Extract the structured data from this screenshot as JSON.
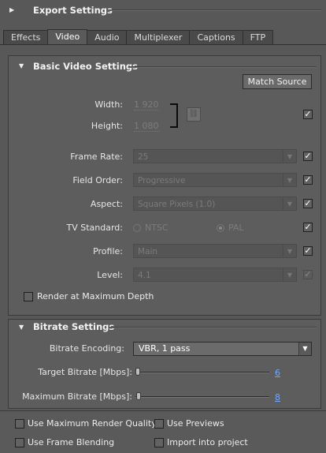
{
  "export_settings": {
    "title": "Export Settings"
  },
  "tabs": [
    "Effects",
    "Video",
    "Audio",
    "Multiplexer",
    "Captions",
    "FTP"
  ],
  "basic_video": {
    "title": "Basic Video Settings",
    "match_source_label": "Match Source",
    "width_label": "Width:",
    "width_value": "1 920",
    "height_label": "Height:",
    "height_value": "1 080",
    "frame_rate_label": "Frame Rate:",
    "frame_rate_value": "25",
    "field_order_label": "Field Order:",
    "field_order_value": "Progressive",
    "aspect_label": "Aspect:",
    "aspect_value": "Square Pixels (1.0)",
    "tv_standard_label": "TV Standard:",
    "tv_ntsc_label": "NTSC",
    "tv_pal_label": "PAL",
    "profile_label": "Profile:",
    "profile_value": "Main",
    "level_label": "Level:",
    "level_value": "4.1",
    "render_max_depth_label": "Render at Maximum Depth",
    "checkmark": "✓"
  },
  "bitrate": {
    "title": "Bitrate Settings",
    "encoding_label": "Bitrate Encoding:",
    "encoding_value": "VBR, 1 pass",
    "target_label": "Target Bitrate [Mbps]:",
    "target_value": "6",
    "max_label": "Maximum Bitrate [Mbps]:",
    "max_value": "8"
  },
  "footer": {
    "use_max_render_quality": "Use Maximum Render Quality",
    "use_previews": "Use Previews",
    "use_frame_blending": "Use Frame Blending",
    "import_into_project": "Import into project"
  },
  "icons": {
    "expand": "▶",
    "collapse": "▼",
    "dropdown": "▼",
    "link": "⛓"
  }
}
